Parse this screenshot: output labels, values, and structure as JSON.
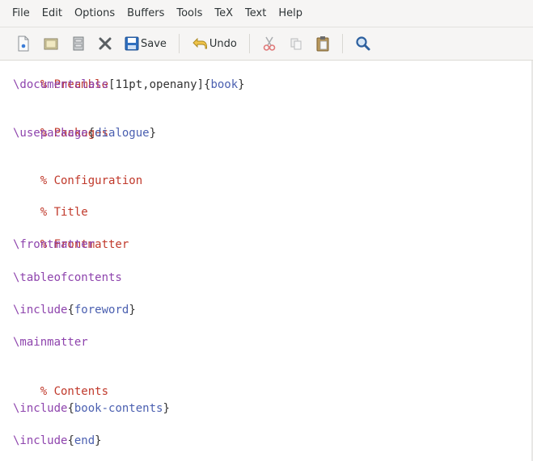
{
  "menu": [
    "File",
    "Edit",
    "Options",
    "Buffers",
    "Tools",
    "TeX",
    "Text",
    "Help"
  ],
  "toolbar": {
    "save_label": "Save",
    "undo_label": "Undo"
  },
  "editor": {
    "lines": [
      {
        "comment": "% Preamble"
      },
      {
        "cmd": "\\documentclass",
        "plain": "[11pt,openany]{",
        "arg": "book",
        "plain2": "}"
      },
      {
        "comment": "% Packages"
      },
      {
        "cmd": "\\usepackage",
        "plain": "{",
        "arg": "dialogue",
        "plain2": "}"
      },
      {
        "comment": "% Configuration"
      },
      {
        "comment": "% Title"
      },
      {
        "comment": "% Frontmatter"
      },
      {
        "cmd": "\\frontmatter"
      },
      {
        "cmd": "\\tableofcontents"
      },
      {
        "cmd": "\\include",
        "plain": "{",
        "arg": "foreword",
        "plain2": "}"
      },
      {
        "cmd": "\\mainmatter"
      },
      {
        "comment": "% Contents"
      },
      {
        "cmd": "\\include",
        "plain": "{",
        "arg": "book-contents",
        "plain2": "}"
      },
      {
        "cmd": "\\include",
        "plain": "{",
        "arg": "end",
        "plain2": "}"
      }
    ]
  }
}
